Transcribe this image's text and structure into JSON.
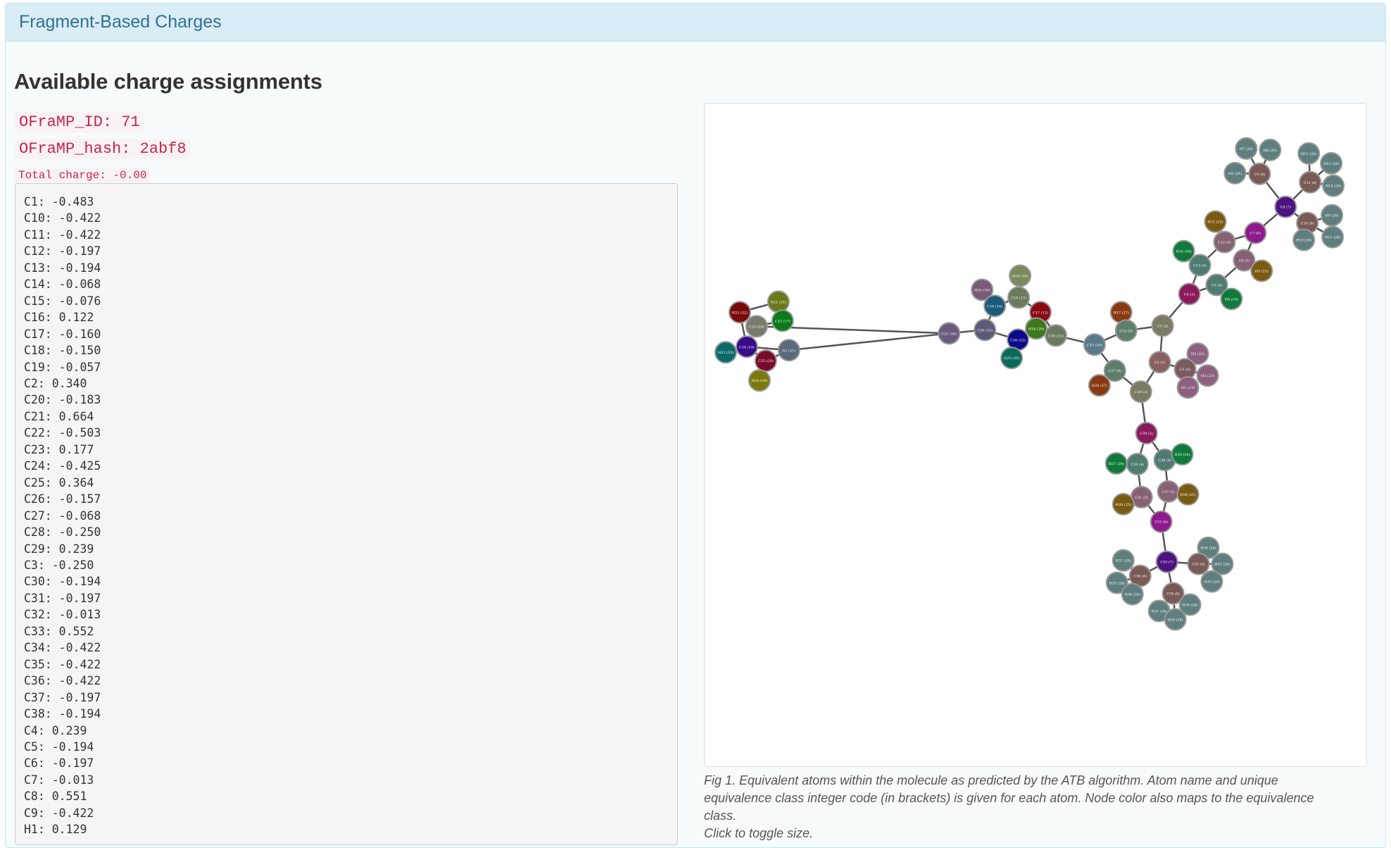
{
  "panel": {
    "title": "Fragment-Based Charges"
  },
  "section": {
    "title": "Available charge assignments"
  },
  "molecule": {
    "id_label": "OFraMP_ID: 71",
    "hash_label": "OFraMP_hash: 2abf8",
    "total_charge_label": "Total charge: -0.00"
  },
  "charges": [
    "C1: -0.483",
    "C10: -0.422",
    "C11: -0.422",
    "C12: -0.197",
    "C13: -0.194",
    "C14: -0.068",
    "C15: -0.076",
    "C16: 0.122",
    "C17: -0.160",
    "C18: -0.150",
    "C19: -0.057",
    "C2: 0.340",
    "C20: -0.183",
    "C21: 0.664",
    "C22: -0.503",
    "C23: 0.177",
    "C24: -0.425",
    "C25: 0.364",
    "C26: -0.157",
    "C27: -0.068",
    "C28: -0.250",
    "C29: 0.239",
    "C3: -0.250",
    "C30: -0.194",
    "C31: -0.197",
    "C32: -0.013",
    "C33: 0.552",
    "C34: -0.422",
    "C35: -0.422",
    "C36: -0.422",
    "C37: -0.197",
    "C38: -0.194",
    "C4: 0.239",
    "C5: -0.194",
    "C6: -0.197",
    "C7: -0.013",
    "C8: 0.551",
    "C9: -0.422",
    "H1: 0.129"
  ],
  "figure": {
    "caption": "Fig 1. Equivalent atoms within the molecule as predicted by the ATB algorithm. Atom name and unique equivalence class integer code (in brackets) is given for each atom. Node color also maps to the equivalence class.",
    "toggle": "Click to toggle size.",
    "nodes": [
      {
        "label": "H7 (26)",
        "color": "#5f7f7f"
      },
      {
        "label": "H8 (26)",
        "color": "#5f7f7f"
      },
      {
        "label": "H9 (26)",
        "color": "#5f7f7f"
      },
      {
        "label": "C9 (8)",
        "color": "#7a5a55"
      },
      {
        "label": "H12 (26)",
        "color": "#5f7f7f"
      },
      {
        "label": "H13 (26)",
        "color": "#5f7f7f"
      },
      {
        "label": "H14 (26)",
        "color": "#5f7f7f"
      },
      {
        "label": "C11 (8)",
        "color": "#7a5a55"
      },
      {
        "label": "C8 (7)",
        "color": "#4b1480"
      },
      {
        "label": "C10 (8)",
        "color": "#7a5a55"
      },
      {
        "label": "H9 (26)",
        "color": "#5f7f7f"
      },
      {
        "label": "H10 (26)",
        "color": "#5f7f7f"
      },
      {
        "label": "H11 (26)",
        "color": "#5f7f7f"
      },
      {
        "label": "C7 (6)",
        "color": "#8e1a8e"
      },
      {
        "label": "H15 (25)",
        "color": "#7a5a10"
      },
      {
        "label": "C12 (5)",
        "color": "#866274"
      },
      {
        "label": "H16 (24)",
        "color": "#0f7a3a"
      },
      {
        "label": "C13 (4)",
        "color": "#4e7b72"
      },
      {
        "label": "C6 (5)",
        "color": "#866274"
      },
      {
        "label": "H5 (25)",
        "color": "#7a5a10"
      },
      {
        "label": "C5 (4)",
        "color": "#4e7b72"
      },
      {
        "label": "C4 (3)",
        "color": "#8b1a5c"
      },
      {
        "label": "H4 (24)",
        "color": "#0f7a3a"
      },
      {
        "label": "C3 (2)",
        "color": "#7c7a62"
      },
      {
        "label": "H17 (27)",
        "color": "#8a3a12"
      },
      {
        "label": "C14 (9)",
        "color": "#5e7e6a"
      },
      {
        "label": "C2 (1)",
        "color": "#8a6060"
      },
      {
        "label": "H2 (23)",
        "color": "#8e6080"
      },
      {
        "label": "C1 (0)",
        "color": "#7a5a60"
      },
      {
        "label": "H3 (23)",
        "color": "#8e6080"
      },
      {
        "label": "H1 (23)",
        "color": "#8e6080"
      },
      {
        "label": "C15 (10)",
        "color": "#5a7a8a"
      },
      {
        "label": "C16 (11)",
        "color": "#6a7a60"
      },
      {
        "label": "C27 (9)",
        "color": "#5e7e6a"
      },
      {
        "label": "H26 (27)",
        "color": "#8a3a12"
      },
      {
        "label": "C28 (2)",
        "color": "#7c7a62"
      },
      {
        "label": "C29 (3)",
        "color": "#8b1a5c"
      },
      {
        "label": "C38 (4)",
        "color": "#4e7b72"
      },
      {
        "label": "H39 (24)",
        "color": "#0f7a3a"
      },
      {
        "label": "H27 (24)",
        "color": "#0f7a3a"
      },
      {
        "label": "C30 (4)",
        "color": "#4e7b72"
      },
      {
        "label": "C37 (5)",
        "color": "#866274"
      },
      {
        "label": "H38 (25)",
        "color": "#7a5a10"
      },
      {
        "label": "C31 (5)",
        "color": "#866274"
      },
      {
        "label": "H28 (25)",
        "color": "#7a5a10"
      },
      {
        "label": "C32 (6)",
        "color": "#8e1a8e"
      },
      {
        "label": "C33 (7)",
        "color": "#4b1480"
      },
      {
        "label": "H34 (26)",
        "color": "#5f7f7f"
      },
      {
        "label": "C35 (8)",
        "color": "#7a5a55"
      },
      {
        "label": "H32 (26)",
        "color": "#5f7f7f"
      },
      {
        "label": "H33 (26)",
        "color": "#5f7f7f"
      },
      {
        "label": "H37 (26)",
        "color": "#5f7f7f"
      },
      {
        "label": "C36 (8)",
        "color": "#7a5a55"
      },
      {
        "label": "H35 (26)",
        "color": "#5f7f7f"
      },
      {
        "label": "H36 (26)",
        "color": "#5f7f7f"
      },
      {
        "label": "C34 (8)",
        "color": "#7a5a55"
      },
      {
        "label": "H30 (26)",
        "color": "#5f7f7f"
      },
      {
        "label": "H31 (26)",
        "color": "#5f7f7f"
      },
      {
        "label": "H29 (26)",
        "color": "#5f7f7f"
      },
      {
        "label": "H19 (28)",
        "color": "#7a8a5a"
      },
      {
        "label": "H20 (30)",
        "color": "#7a5a7a"
      },
      {
        "label": "C18 (13)",
        "color": "#6a7a5a"
      },
      {
        "label": "C19 (14)",
        "color": "#1a5a7a"
      },
      {
        "label": "C17 (12)",
        "color": "#8a0a14"
      },
      {
        "label": "H18 (28)",
        "color": "#3a7a1a"
      },
      {
        "label": "C20 (15)",
        "color": "#5a5a7a"
      },
      {
        "label": "C26 (22)",
        "color": "#0a0a8a"
      },
      {
        "label": "H25 (35)",
        "color": "#0a6a5a"
      },
      {
        "label": "C21 (16)",
        "color": "#6a5a80"
      },
      {
        "label": "H21 (31)",
        "color": "#6a7a1a"
      },
      {
        "label": "C22 (17)",
        "color": "#0a7a1a"
      },
      {
        "label": "H22 (32)",
        "color": "#7a0a0a"
      },
      {
        "label": "C23 (18)",
        "color": "#7a7a6a"
      },
      {
        "label": "C24 (19)",
        "color": "#3a0a8a"
      },
      {
        "label": "N1 (21)",
        "color": "#5a6a7a"
      },
      {
        "label": "C25 (20)",
        "color": "#7a0a2a"
      },
      {
        "label": "H23 (33)",
        "color": "#0a6a6a"
      },
      {
        "label": "H24 (34)",
        "color": "#7a7a0a"
      }
    ]
  }
}
